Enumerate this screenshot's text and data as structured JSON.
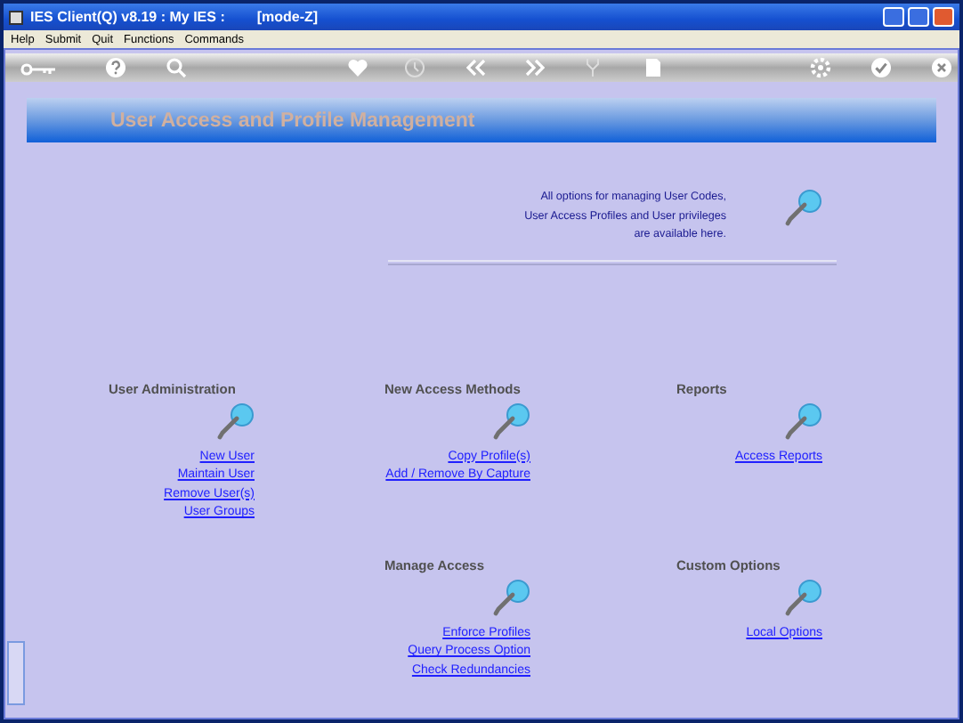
{
  "window": {
    "title": "IES Client(Q) v8.19 : My IES :",
    "mode": "[mode-Z]"
  },
  "menu": [
    "Help",
    "Submit",
    "Quit",
    "Functions",
    "Commands"
  ],
  "banner": {
    "title": "User Access and Profile Management"
  },
  "intro": {
    "lines": [
      "All options for managing User Codes,",
      "User Access Profiles and User privileges",
      "are available here."
    ]
  },
  "rows": [
    {
      "sections": [
        {
          "title": "User Administration",
          "links": [
            "New User",
            "Maintain User",
            "Remove User(s)",
            "User Groups"
          ]
        },
        {
          "title": "New Access Methods",
          "links": [
            "Copy Profile(s)",
            "Add / Remove By Capture"
          ]
        },
        {
          "title": "Reports",
          "links": [
            "Access Reports"
          ]
        }
      ]
    },
    {
      "sections": [
        {
          "title": "Manage Access",
          "links": [
            "Enforce Profiles",
            "Query Process Option",
            "Check Redundancies"
          ]
        },
        {
          "title": "Custom Options",
          "links": [
            "Local Options"
          ]
        }
      ]
    }
  ]
}
